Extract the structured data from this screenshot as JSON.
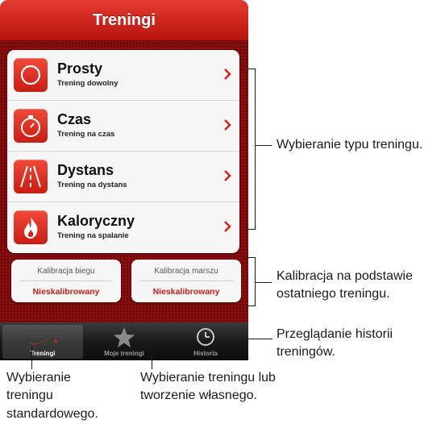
{
  "header": {
    "title": "Treningi"
  },
  "workout_types": [
    {
      "title": "Prosty",
      "subtitle": "Trening dowolny",
      "icon": "circle-icon"
    },
    {
      "title": "Czas",
      "subtitle": "Trening na czas",
      "icon": "stopwatch-icon"
    },
    {
      "title": "Dystans",
      "subtitle": "Trening na dystans",
      "icon": "road-icon"
    },
    {
      "title": "Kaloryczny",
      "subtitle": "Trening na spalanie",
      "icon": "flame-icon"
    }
  ],
  "calibration": [
    {
      "label": "Kalibracja biegu",
      "status": "Nieskalibrowany"
    },
    {
      "label": "Kalibracja marszu",
      "status": "Nieskalibrowany"
    }
  ],
  "tabs": [
    {
      "label": "Treningi",
      "icon": "nike-swoosh-icon",
      "active": true
    },
    {
      "label": "Moje treningi",
      "icon": "star-icon",
      "active": false
    },
    {
      "label": "Historia",
      "icon": "clock-icon",
      "active": false
    }
  ],
  "callouts": {
    "workout_type": "Wybieranie typu treningu.",
    "calibration": "Kalibracja na podstawie ostatniego treningu.",
    "history": "Przeglądanie historii treningów.",
    "standard": "Wybieranie treningu standardowego.",
    "custom": "Wybieranie treningu lub tworzenie własnego."
  },
  "colors": {
    "accent_red": "#c91b14",
    "background_red": "#8e0b0c",
    "tabbar": "#1a1a1a"
  }
}
